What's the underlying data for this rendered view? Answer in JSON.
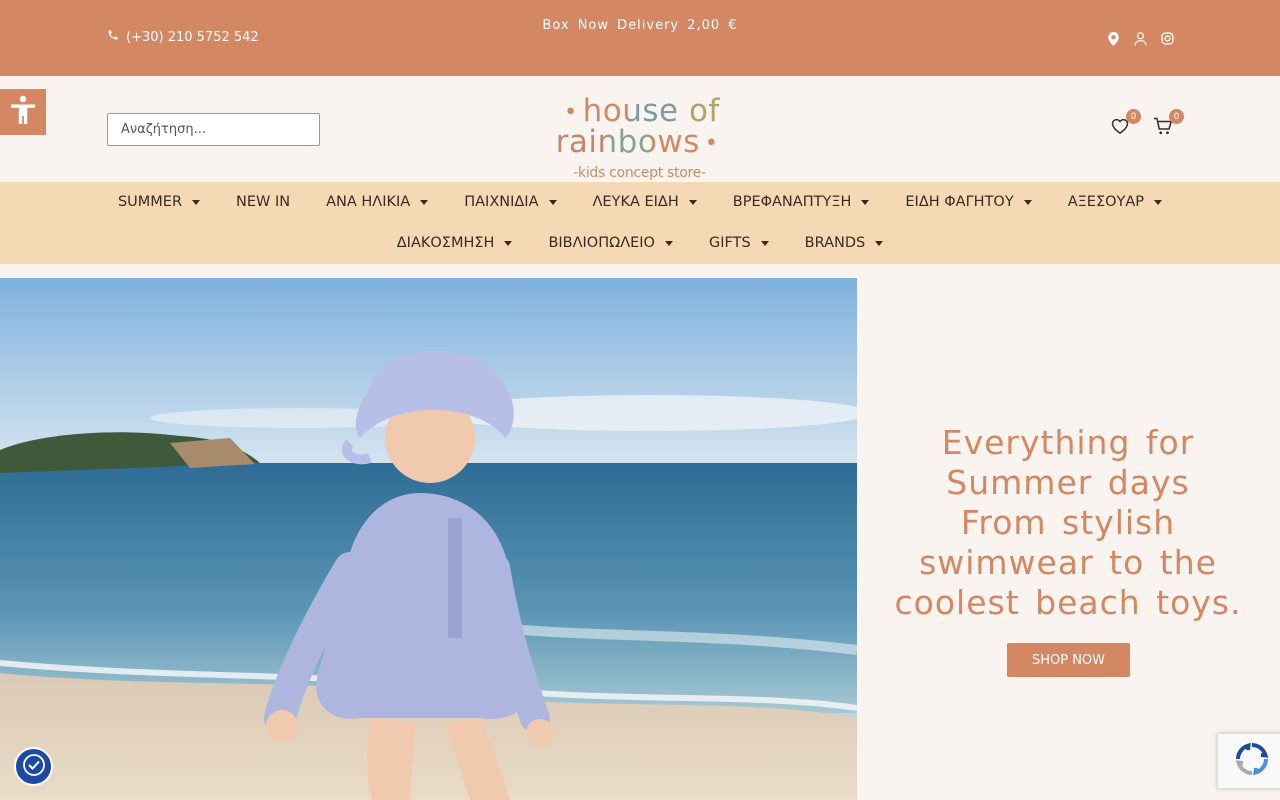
{
  "topbar": {
    "phone": "(+30) 210 5752 542",
    "promo": "Box Now Delivery 2,00 €",
    "icons": [
      "location-icon",
      "user-icon",
      "instagram-icon"
    ]
  },
  "header": {
    "search_placeholder": "Αναζήτηση...",
    "logo_main": "house of rainbows",
    "logo_sub": "-kids concept store-",
    "wishlist_count": "0",
    "cart_count": "0"
  },
  "nav": {
    "row1": [
      {
        "label": "SUMMER",
        "dropdown": true
      },
      {
        "label": "NEW IN",
        "dropdown": false
      },
      {
        "label": "ΑΝΑ ΗΛΙΚΙΑ",
        "dropdown": true
      },
      {
        "label": "ΠΑΙΧΝΙΔΙΑ",
        "dropdown": true
      },
      {
        "label": "ΛΕΥΚΑ ΕΙΔΗ",
        "dropdown": true
      },
      {
        "label": "ΒΡΕΦΑΝΑΠΤΥΞΗ",
        "dropdown": true
      },
      {
        "label": "ΕΙΔΗ ΦΑΓΗΤΟΥ",
        "dropdown": true
      },
      {
        "label": "ΑΞΕΣΟΥΑΡ",
        "dropdown": true
      }
    ],
    "row2": [
      {
        "label": "ΔΙΑΚΟΣΜΗΣΗ",
        "dropdown": true
      },
      {
        "label": "ΒΙΒΛΙΟΠΩΛΕΙΟ",
        "dropdown": true
      },
      {
        "label": "GIFTS",
        "dropdown": true
      },
      {
        "label": "BRANDS",
        "dropdown": true
      }
    ]
  },
  "hero": {
    "headline_line1": "Everything for Summer days",
    "headline_line2": "From stylish swimwear to the coolest beach toys.",
    "cta": "SHOP NOW"
  },
  "colors": {
    "accent": "#d48763",
    "nav_bg": "#f5d9b4",
    "page_bg": "#f9f4ef"
  }
}
